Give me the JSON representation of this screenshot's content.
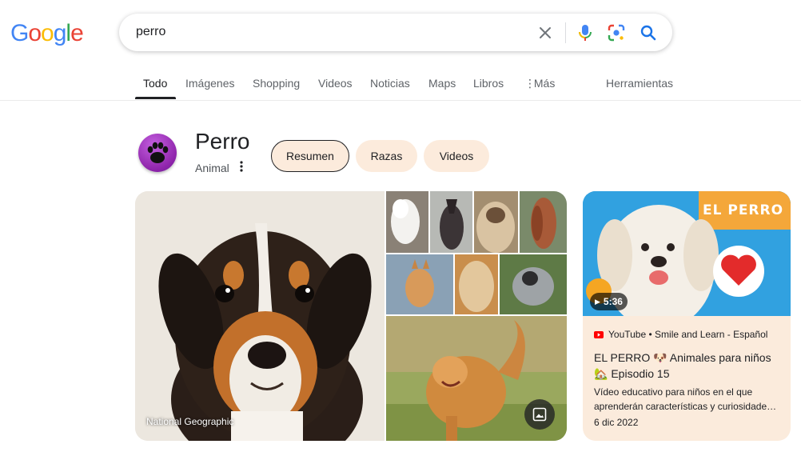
{
  "logo": {
    "letters": [
      "G",
      "o",
      "o",
      "g",
      "l",
      "e"
    ],
    "colors": [
      "#4285f4",
      "#ea4335",
      "#fbbc05",
      "#4285f4",
      "#34a853",
      "#ea4335"
    ]
  },
  "search": {
    "query": "perro"
  },
  "tabs": [
    {
      "label": "Todo",
      "active": true
    },
    {
      "label": "Imágenes"
    },
    {
      "label": "Shopping"
    },
    {
      "label": "Videos"
    },
    {
      "label": "Noticias"
    },
    {
      "label": "Maps"
    },
    {
      "label": "Libros"
    },
    {
      "label": "Más"
    },
    {
      "label": "Herramientas"
    }
  ],
  "entity": {
    "title": "Perro",
    "subtitle": "Animal",
    "icon": "paw-icon"
  },
  "chips": [
    {
      "label": "Resumen",
      "active": true
    },
    {
      "label": "Razas"
    },
    {
      "label": "Videos"
    }
  ],
  "images": {
    "main_caption": "National Geographic"
  },
  "video": {
    "duration": "5:36",
    "source": "YouTube • Smile and Learn - Español",
    "title_part1": "EL PERRO",
    "title_part2": "Animales para niños",
    "title_part3": "Episodio 15",
    "description": "Vídeo educativo para niños en el que aprenderán características y curiosidade…",
    "date": "6 dic 2022",
    "thumb_text": "EL PERRO"
  },
  "colors": {
    "chip_bg": "#fcebdc",
    "card_bg": "#fbebdc",
    "accent": "#1a73e8"
  }
}
